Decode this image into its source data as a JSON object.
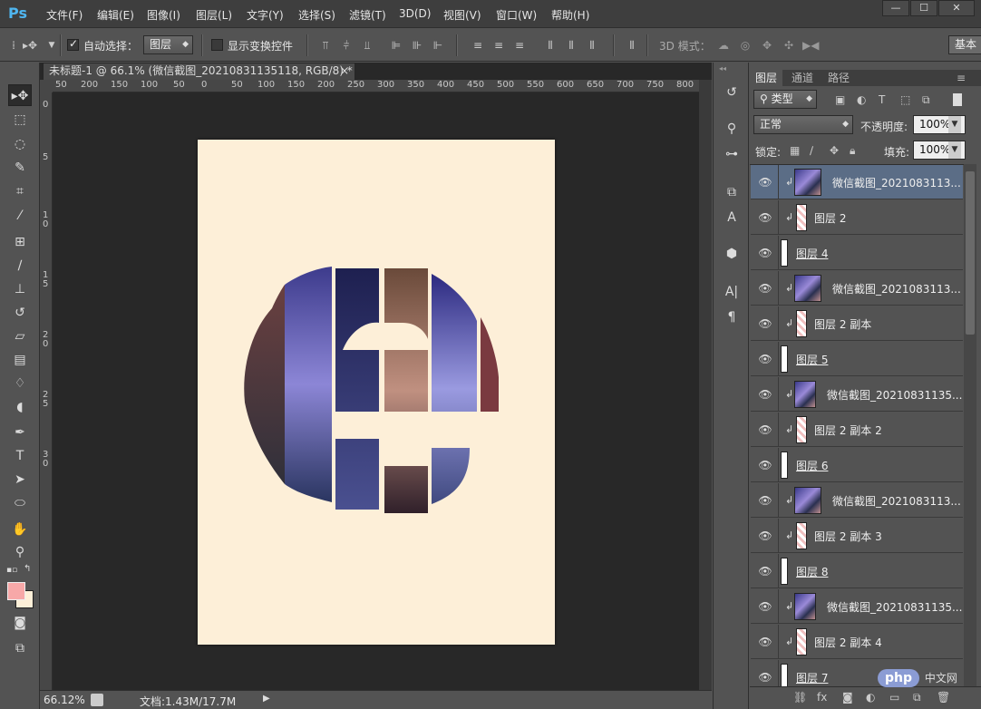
{
  "app": {
    "logo": "Ps",
    "menu": [
      "文件(F)",
      "编辑(E)",
      "图像(I)",
      "图层(L)",
      "文字(Y)",
      "选择(S)",
      "滤镜(T)",
      "3D(D)",
      "视图(V)",
      "窗口(W)",
      "帮助(H)"
    ],
    "window_controls": [
      "—",
      "☐",
      "✕"
    ]
  },
  "options": {
    "auto_select_label": "自动选择：",
    "auto_select_value": "图层",
    "show_transform_label": "显示变换控件",
    "mode_3d_label": "3D 模式：",
    "workspace": "基本"
  },
  "document": {
    "tab_title": "未标题-1 @ 66.1% (微信截图_20210831135118, RGB/8) *",
    "tab_close": "×",
    "ruler_h": [
      "50",
      "200",
      "150",
      "100",
      "50",
      "0",
      "50",
      "100",
      "150",
      "200",
      "250",
      "300",
      "350",
      "400",
      "450",
      "500",
      "550",
      "600",
      "650",
      "700",
      "750",
      "800"
    ],
    "ruler_v": [
      "0",
      "5",
      "1",
      "0",
      "1",
      "5",
      "2",
      "0",
      "2",
      "5",
      "3",
      "0"
    ],
    "zoom": "66.12%",
    "doc_info": "文档:1.43M/17.7M",
    "canvas_colors": {
      "page": "#fdefd8",
      "pasteboard": "#282828"
    }
  },
  "layers_panel": {
    "tabs": [
      "图层",
      "通道",
      "路径"
    ],
    "filter_kind": "类型",
    "blend_mode": "正常",
    "opacity_label": "不透明度:",
    "opacity_value": "100%",
    "lock_label": "锁定:",
    "fill_label": "填充:",
    "fill_value": "100%",
    "layers": [
      {
        "name": "微信截图_2021083113...",
        "type": "photo",
        "selected": true
      },
      {
        "name": "图层 2",
        "type": "mask"
      },
      {
        "name": "图层 4",
        "type": "group"
      },
      {
        "name": "微信截图_2021083113...",
        "type": "photo"
      },
      {
        "name": "图层 2 副本",
        "type": "mask"
      },
      {
        "name": "图层 5",
        "type": "group"
      },
      {
        "name": "微信截图_20210831135...",
        "type": "photo"
      },
      {
        "name": "图层 2 副本 2",
        "type": "mask"
      },
      {
        "name": "图层 6",
        "type": "group"
      },
      {
        "name": "微信截图_2021083113...",
        "type": "photo"
      },
      {
        "name": "图层 2 副本 3",
        "type": "mask"
      },
      {
        "name": "图层 8",
        "type": "group"
      },
      {
        "name": "微信截图_20210831135...",
        "type": "photo"
      },
      {
        "name": "图层 2 副本 4",
        "type": "mask"
      },
      {
        "name": "图层 7",
        "type": "group"
      }
    ]
  },
  "watermark": {
    "text": "php",
    "suffix": "中文网"
  }
}
